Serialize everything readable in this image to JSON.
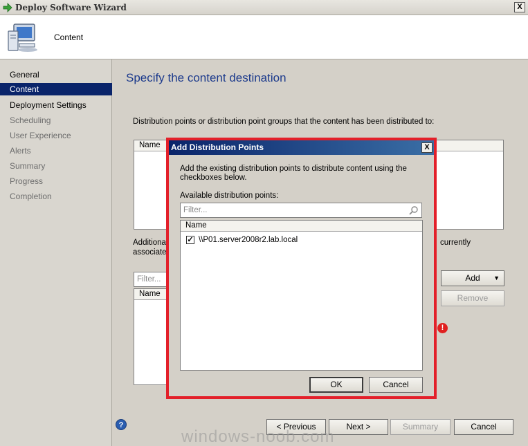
{
  "window": {
    "title": "Deploy Software Wizard",
    "close_label": "X"
  },
  "header": {
    "title": "Content",
    "icon": "computer-icon"
  },
  "sidebar": {
    "items": [
      {
        "label": "General"
      },
      {
        "label": "Content"
      },
      {
        "label": "Deployment Settings"
      },
      {
        "label": "Scheduling"
      },
      {
        "label": "User Experience"
      },
      {
        "label": "Alerts"
      },
      {
        "label": "Summary"
      },
      {
        "label": "Progress"
      },
      {
        "label": "Completion"
      }
    ]
  },
  "main": {
    "heading": "Specify the content destination",
    "description": "Distribution points or distribution point groups that the content has been distributed to:",
    "list1_column": "Name",
    "additional_fragment": "Additional",
    "associated_fragment": "associated",
    "currently_fragment": "currently",
    "filter_placeholder": "Filter...",
    "list2_column": "Name",
    "add_button": "Add",
    "remove_button": "Remove"
  },
  "dialog": {
    "title": "Add Distribution Points",
    "close_label": "X",
    "instruction": "Add the existing distribution points to distribute content using the checkboxes below.",
    "available_label": "Available distribution points:",
    "filter_placeholder": "Filter...",
    "column_header": "Name",
    "items": [
      {
        "label": "\\\\P01.server2008r2.lab.local",
        "checked": true
      }
    ],
    "ok_button": "OK",
    "cancel_button": "Cancel"
  },
  "footer": {
    "help_label": "?",
    "previous_button": "< Previous",
    "next_button": "Next >",
    "summary_button": "Summary",
    "cancel_button": "Cancel"
  },
  "watermark": "windows-noob.com",
  "colors": {
    "highlight_border": "#e3202a",
    "selection": "#0a246a",
    "heading": "#1c3a8c"
  }
}
